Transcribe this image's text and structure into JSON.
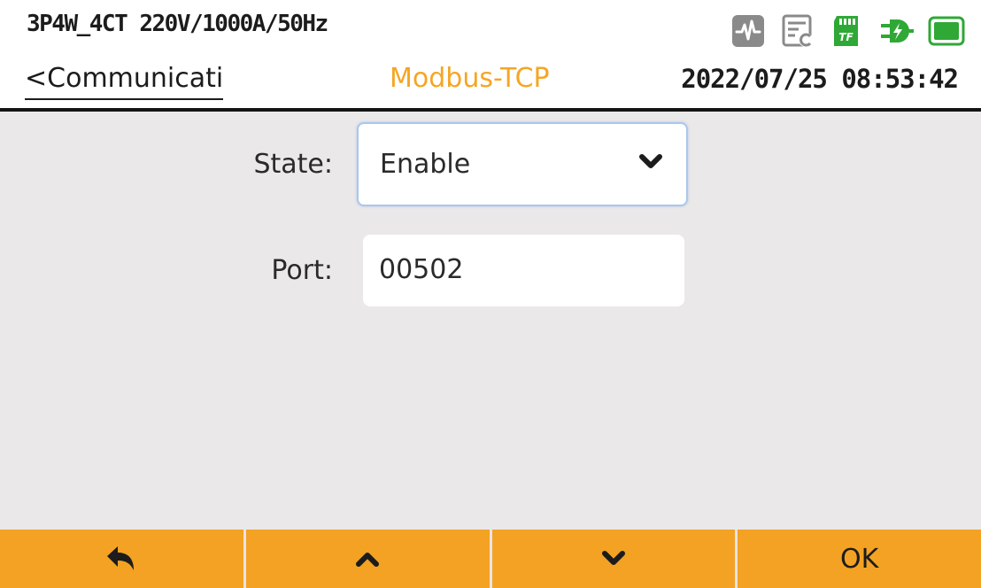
{
  "header": {
    "wiring_config": "3P4W_4CT 220V/1000A/50Hz",
    "back_link": "<Communicati",
    "title": "Modbus-TCP",
    "datetime": "2022/07/25 08:53:42",
    "status_icons": [
      "waveform-icon",
      "report-icon",
      "tf-card-icon",
      "power-plug-icon",
      "battery-icon"
    ],
    "tf_card_text": "TF"
  },
  "form": {
    "state_label": "State:",
    "state_value": "Enable",
    "port_label": "Port:",
    "port_value": "00502"
  },
  "softkeys": {
    "back_icon": "back-arrow-icon",
    "up_icon": "chevron-up-icon",
    "down_icon": "chevron-down-icon",
    "ok_label": "OK"
  },
  "colors": {
    "accent": "#f5a623",
    "softkey_bar": "#f3a223",
    "icon_gray": "#8a8a8a",
    "icon_green": "#2fa836",
    "background": "#ebe8ea"
  }
}
